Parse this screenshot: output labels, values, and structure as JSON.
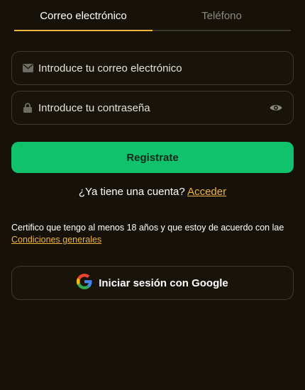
{
  "tabs": [
    {
      "label": "Correo electrónico",
      "active": true
    },
    {
      "label": "Teléfono",
      "active": false
    }
  ],
  "form": {
    "email_placeholder": "Introduce tu correo electrónico",
    "password_placeholder": "Introduce tu contraseña",
    "email_icon": "envelope-icon",
    "password_icon": "lock-icon",
    "visibility_icon": "eye-icon"
  },
  "register_button": {
    "label": "Registrate"
  },
  "login_prompt": {
    "text": "¿Ya tiene una cuenta? ",
    "link": "Acceder"
  },
  "terms": {
    "text": "Certifico que tengo al menos 18 años y que estoy de acuerdo con lae",
    "link": "Condiciones generales"
  },
  "google_button": {
    "label": "Iniciar sesión con Google",
    "icon": "google-icon"
  },
  "colors": {
    "background": "#161209",
    "accent": "#f0b53a",
    "primary_button": "#11c26d",
    "border": "#3d3a31"
  }
}
